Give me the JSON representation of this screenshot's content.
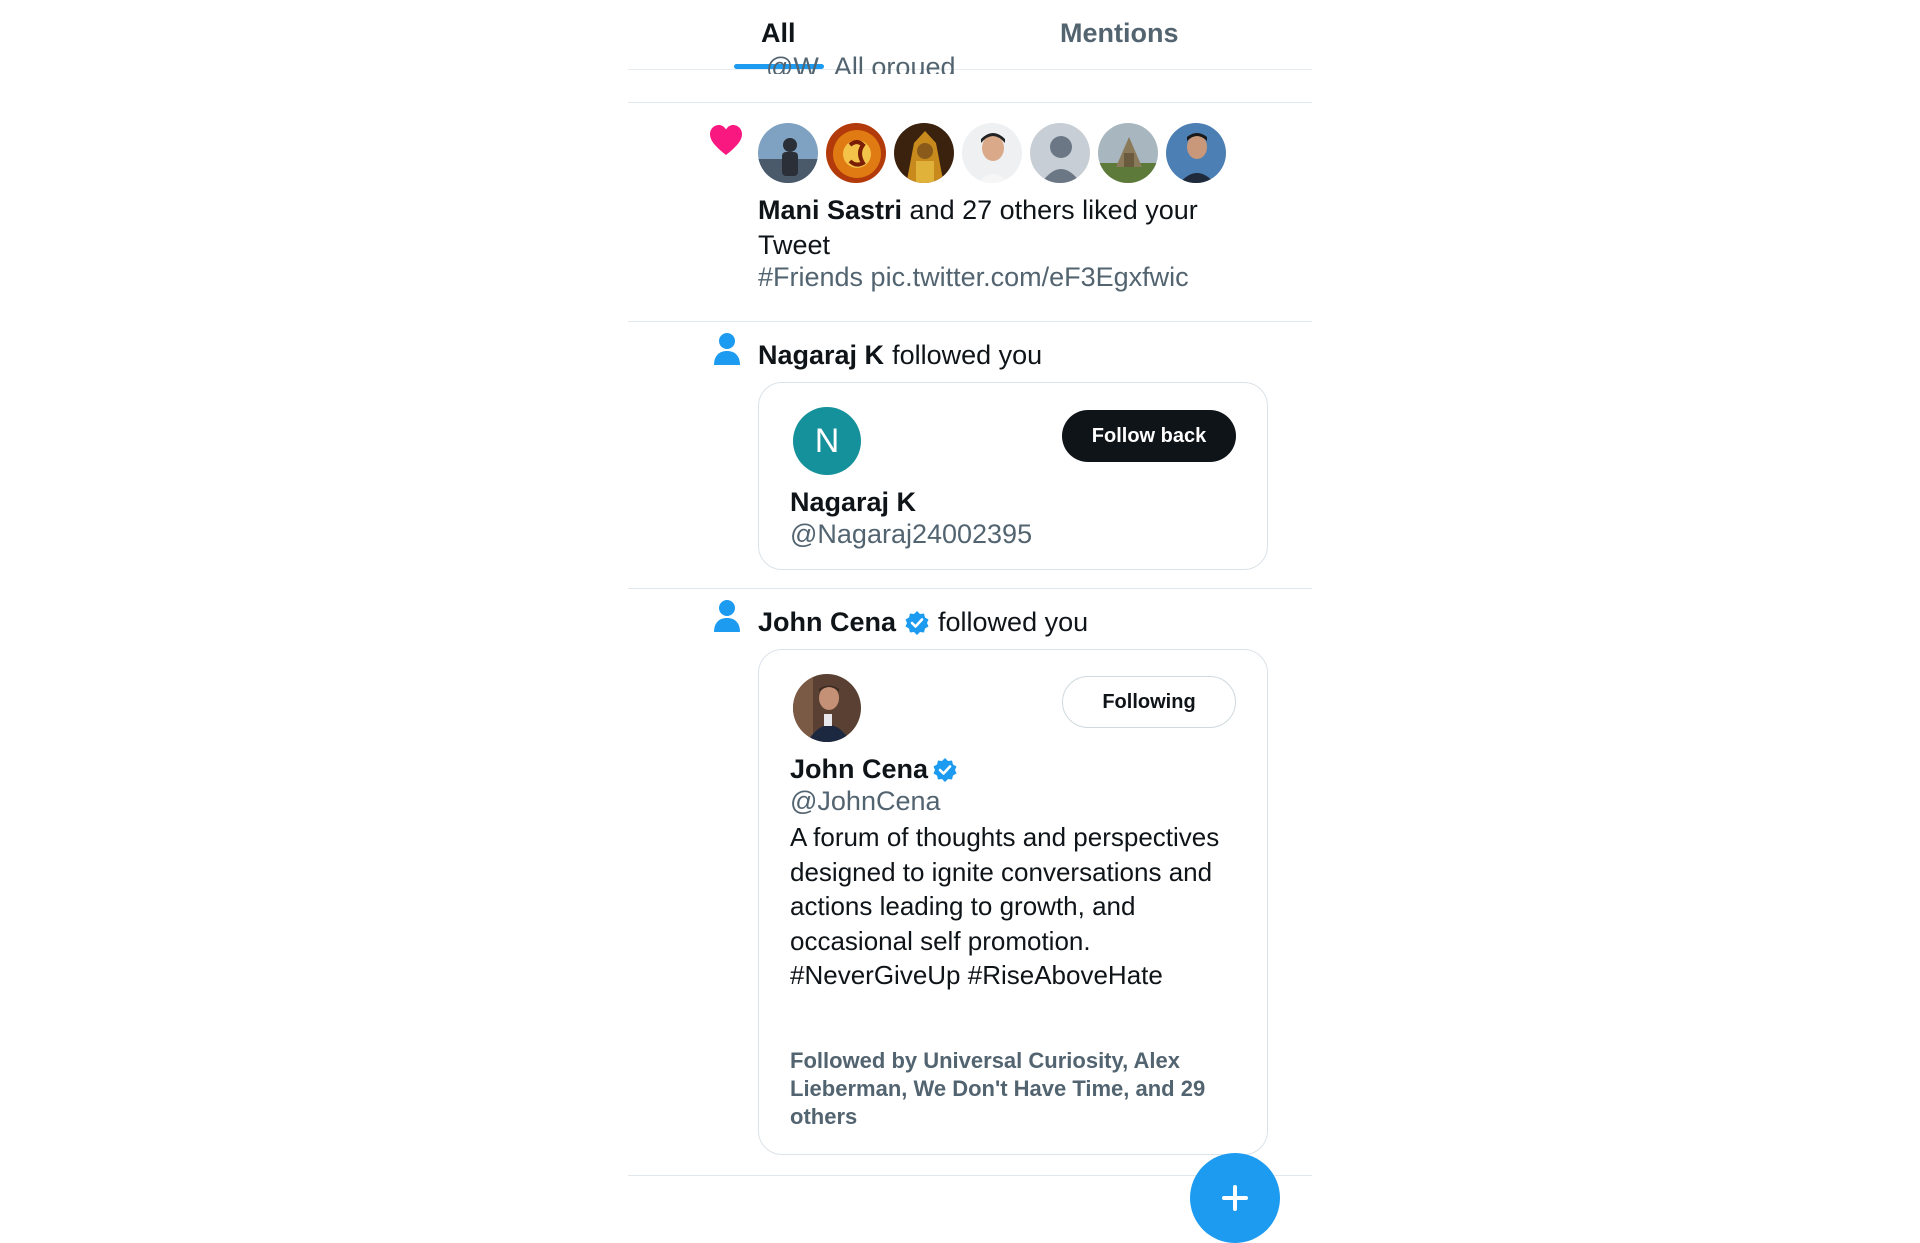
{
  "tabs": {
    "all": "All",
    "mentions": "Mentions"
  },
  "clipped_previous_text": "@W_All oroued",
  "like_notification": {
    "icon": "heart-icon",
    "actor": "Mani Sastri",
    "text": " and 27 others liked your Tweet",
    "tweet_text": "#Friends pic.twitter.com/eF3Egxfwic",
    "avatars": [
      "avatar-1",
      "avatar-2",
      "avatar-3",
      "avatar-4",
      "avatar-5",
      "avatar-6",
      "avatar-7"
    ]
  },
  "follow_notifications": [
    {
      "icon": "person-icon",
      "actor": "Nagaraj K",
      "text": "followed you",
      "card": {
        "avatar_letter": "N",
        "button": "Follow back",
        "name": "Nagaraj K",
        "handle": "@Nagaraj24002395"
      }
    },
    {
      "icon": "person-icon",
      "actor": "John Cena",
      "verified": true,
      "text": "followed you",
      "card": {
        "button": "Following",
        "name": "John Cena",
        "handle": "@JohnCena",
        "bio": "A forum of thoughts and perspectives designed to ignite conversations and actions leading to growth, and occasional self promotion. #NeverGiveUp #RiseAboveHate",
        "followed_by": "Followed by Universal Curiosity, Alex Lieberman, We Don't Have Time, and 29 others"
      }
    }
  ],
  "fab": {
    "icon": "plus-icon"
  },
  "colors": {
    "accent": "#1d9bf0",
    "heart": "#f91880",
    "text": "#0f1419",
    "secondary": "#536471",
    "card_border": "#dbe2e8"
  }
}
